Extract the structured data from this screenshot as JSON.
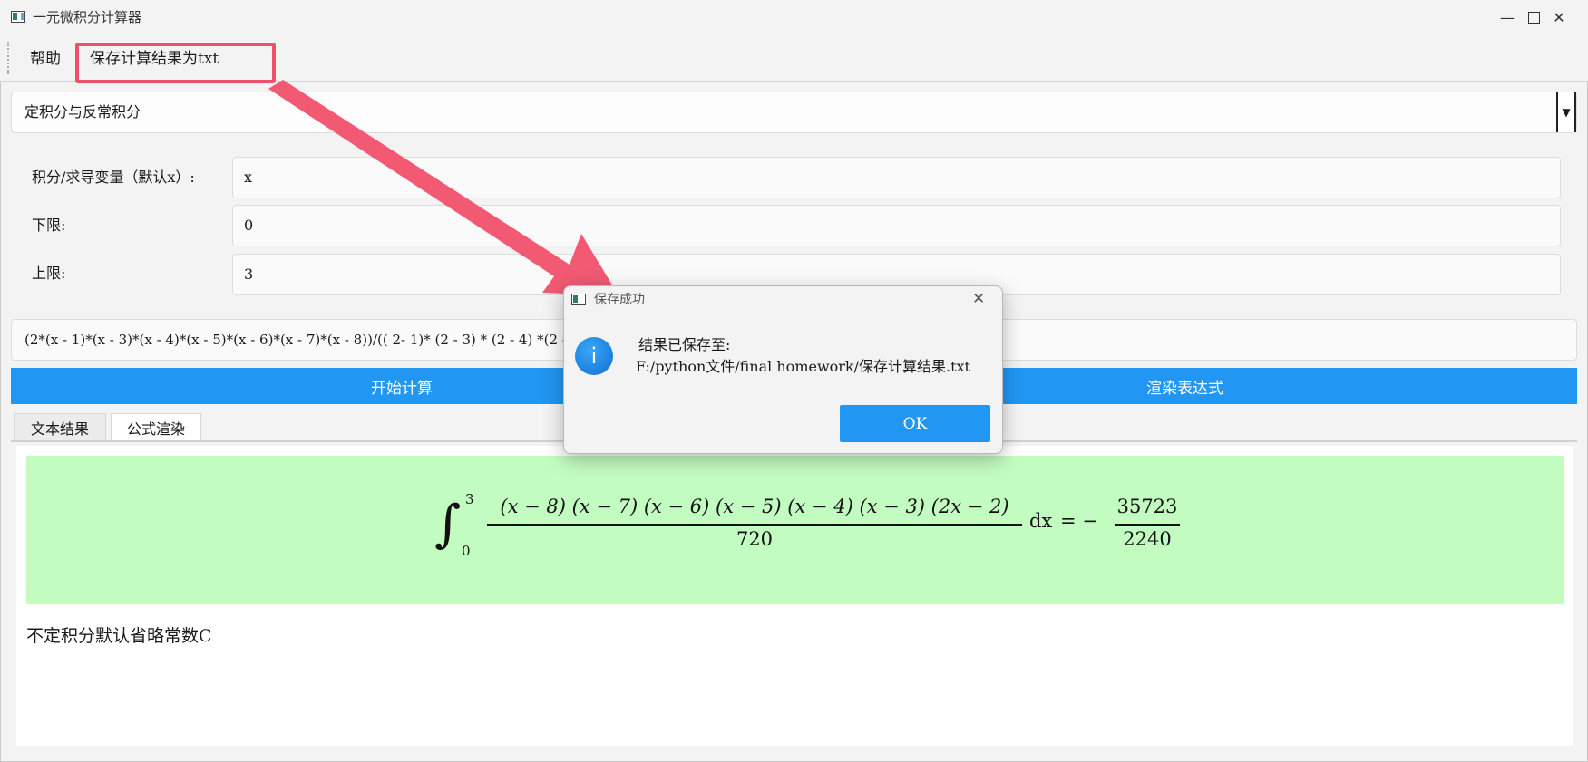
{
  "window": {
    "title": "一元微积分计算器"
  },
  "menu": {
    "help": "帮助",
    "save": "保存计算结果为txt"
  },
  "mode_select": {
    "value": "定积分与反常积分"
  },
  "form": {
    "variable_label": "积分/求导变量（默认x）:",
    "variable_value": "x",
    "lower_label": "下限:",
    "lower_value": "0",
    "upper_label": "上限:",
    "upper_value": "3"
  },
  "expression": {
    "value": "(2*(x - 1)*(x - 3)*(x - 4)*(x - 5)*(x - 6)*(x - 7)*(x - 8))/(( 2-  1)* (2 - 3) * (2 - 4) *(2 - 5)* (2 - 6) * (2 - 7) * (2 - 8))"
  },
  "buttons": {
    "compute": "开始计算",
    "render": "渲染表达式"
  },
  "tabs": {
    "text_result": "文本结果",
    "formula_render": "公式渲染"
  },
  "result": {
    "integral_upper": "3",
    "integral_lower": "0",
    "numerator": "(x − 8) (x − 7) (x − 6) (x − 5) (x − 4) (x − 3) (2x − 2)",
    "denominator": "720",
    "differential": "dx",
    "equals": "= −",
    "result_numerator": "35723",
    "result_denominator": "2240",
    "note": "不定积分默认省略常数C"
  },
  "dialog": {
    "title": "保存成功",
    "message_line1": "结果已保存至:",
    "message_line2": "F:/python文件/final homework/保存计算结果.txt",
    "ok": "OK"
  },
  "colors": {
    "accent": "#2196f3",
    "highlight": "#f0516a",
    "formula_bg": "#c3fcc1"
  }
}
